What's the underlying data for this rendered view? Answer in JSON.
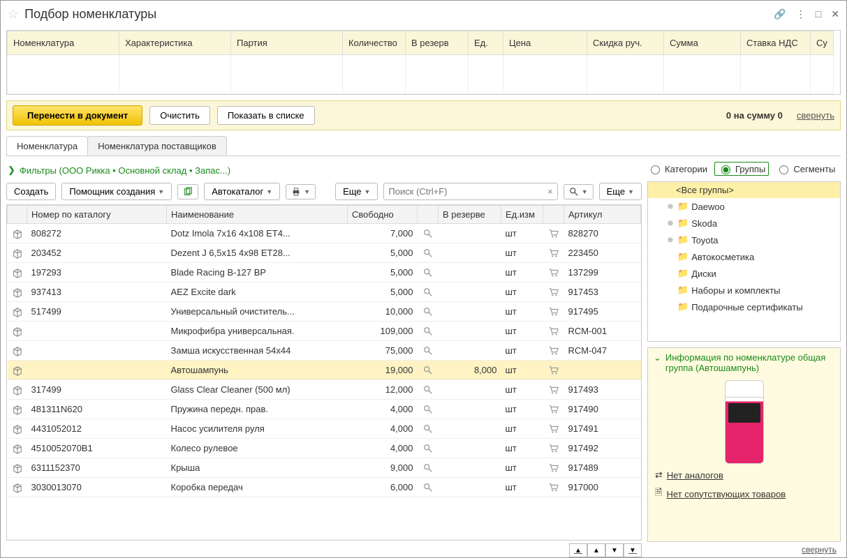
{
  "title": "Подбор номенклатуры",
  "upperColumns": [
    "Номенклатура",
    "Характеристика",
    "Партия",
    "Количество",
    "В резерв",
    "Ед.",
    "Цена",
    "Скидка руч.",
    "Сумма",
    "Ставка НДС",
    "Су"
  ],
  "upperWidths": [
    160,
    160,
    160,
    90,
    90,
    50,
    120,
    110,
    110,
    100,
    30
  ],
  "actionBar": {
    "transfer": "Перенести в документ",
    "clear": "Очистить",
    "showList": "Показать в списке",
    "summary_prefix": "0 на сумму ",
    "summary_value": "0",
    "collapse": "свернуть"
  },
  "tabs": {
    "t1": "Номенклатура",
    "t2": "Номенклатура поставщиков"
  },
  "filterText": "Фильтры (ООО Рикка • Основной склад • Запас...)",
  "toolbar": {
    "create": "Создать",
    "assistant": "Помощник создания",
    "autocatalog": "Автокаталог",
    "more": "Еще",
    "searchPlaceholder": "Поиск (Ctrl+F)"
  },
  "gridHeaders": {
    "num": "Номер по каталогу",
    "name": "Наименование",
    "free": "Свободно",
    "res": "В резерве",
    "unit": "Ед.изм",
    "art": "Артикул"
  },
  "rows": [
    {
      "num": "808272",
      "name": "Dotz Imola 7x16 4x108 ET4...",
      "free": "7,000",
      "res": "",
      "unit": "шт",
      "art": "828270"
    },
    {
      "num": "203452",
      "name": "Dezent J 6,5x15 4x98 ET28...",
      "free": "5,000",
      "res": "",
      "unit": "шт",
      "art": "223450"
    },
    {
      "num": "197293",
      "name": "Blade Racing B-127 BP",
      "free": "5,000",
      "res": "",
      "unit": "шт",
      "art": "137299"
    },
    {
      "num": "937413",
      "name": "AEZ Excite dark",
      "free": "5,000",
      "res": "",
      "unit": "шт",
      "art": "917453"
    },
    {
      "num": "517499",
      "name": "Универсальный очиститель...",
      "free": "10,000",
      "res": "",
      "unit": "шт",
      "art": "917495"
    },
    {
      "num": "",
      "name": "Микрофибра универсальная.",
      "free": "109,000",
      "res": "",
      "unit": "шт",
      "art": "RCM-001"
    },
    {
      "num": "",
      "name": "Замша искусственная 54x44",
      "free": "75,000",
      "res": "",
      "unit": "шт",
      "art": "RCM-047"
    },
    {
      "num": "",
      "name": "Автошампунь",
      "free": "19,000",
      "res": "8,000",
      "unit": "шт",
      "art": "",
      "hl": true
    },
    {
      "num": "317499",
      "name": "Glass Clear Cleaner (500 мл)",
      "free": "12,000",
      "res": "",
      "unit": "шт",
      "art": "917493"
    },
    {
      "num": "481311N620",
      "name": "Пружина передн. прав.",
      "free": "4,000",
      "res": "",
      "unit": "шт",
      "art": "917490"
    },
    {
      "num": "4431052012",
      "name": "Насос усилителя руля",
      "free": "4,000",
      "res": "",
      "unit": "шт",
      "art": "917491"
    },
    {
      "num": "4510052070B1",
      "name": "Колесо рулевое",
      "free": "4,000",
      "res": "",
      "unit": "шт",
      "art": "917492"
    },
    {
      "num": "6311152370",
      "name": "Крыша",
      "free": "9,000",
      "res": "",
      "unit": "шт",
      "art": "917489"
    },
    {
      "num": "3030013070",
      "name": "Коробка передач",
      "free": "6,000",
      "res": "",
      "unit": "шт",
      "art": "917000"
    }
  ],
  "radios": {
    "cat": "Категории",
    "grp": "Группы",
    "seg": "Сегменты"
  },
  "tree": [
    {
      "txt": "<Все группы>",
      "sel": true,
      "exp": "",
      "ind": 0,
      "folder": false
    },
    {
      "txt": "Daewoo",
      "exp": "⊕",
      "ind": 1,
      "folder": true
    },
    {
      "txt": "Skoda",
      "exp": "⊕",
      "ind": 1,
      "folder": true
    },
    {
      "txt": "Toyota",
      "exp": "⊕",
      "ind": 1,
      "folder": true
    },
    {
      "txt": "Автокосметика",
      "exp": "",
      "ind": 1,
      "folder": true
    },
    {
      "txt": "Диски",
      "exp": "",
      "ind": 1,
      "folder": true
    },
    {
      "txt": "Наборы и комплекты",
      "exp": "",
      "ind": 1,
      "folder": true
    },
    {
      "txt": "Подарочные сертификаты",
      "exp": "",
      "ind": 1,
      "folder": true
    }
  ],
  "info": {
    "heading": "Информация по номенклатуре общая группа (Автошампунь)",
    "noAnalogs": "Нет аналогов",
    "noRelated": "Нет сопутствующих товаров",
    "collapse": "свернуть"
  }
}
